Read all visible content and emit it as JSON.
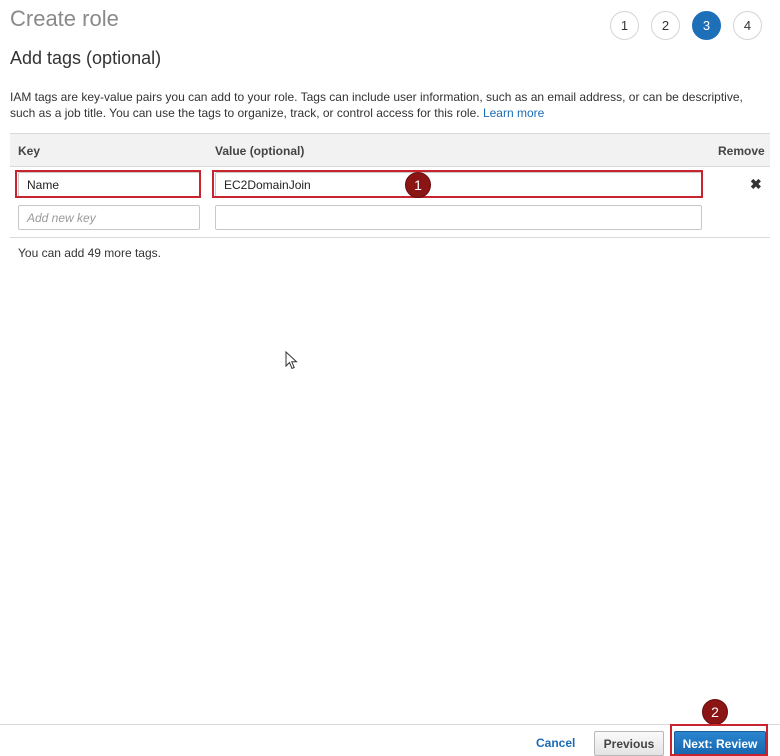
{
  "page": {
    "title": "Create role"
  },
  "steps": [
    "1",
    "2",
    "3",
    "4"
  ],
  "active_step": "3",
  "section": {
    "title": "Add tags (optional)",
    "description": "IAM tags are key-value pairs you can add to your role. Tags can include user information, such as an email address, or can be descriptive, such as a job title. You can use the tags to organize, track, or control access for this role.",
    "learn_more": "Learn more"
  },
  "table": {
    "headers": {
      "key": "Key",
      "value": "Value (optional)",
      "remove": "Remove"
    },
    "rows": [
      {
        "key": "Name",
        "value": "EC2DomainJoin",
        "remove_icon": "✖"
      }
    ],
    "new_row": {
      "key_placeholder": "Add new key",
      "value_placeholder": ""
    }
  },
  "remaining_text": "You can add 49 more tags.",
  "annotations": {
    "badge1": "1",
    "badge2": "2"
  },
  "footer": {
    "cancel": "Cancel",
    "previous": "Previous",
    "next": "Next: Review"
  },
  "colors": {
    "accent": "#1d6fb8",
    "highlight": "#c8242f",
    "badge": "#8b1414",
    "link": "#1a6bb5"
  }
}
